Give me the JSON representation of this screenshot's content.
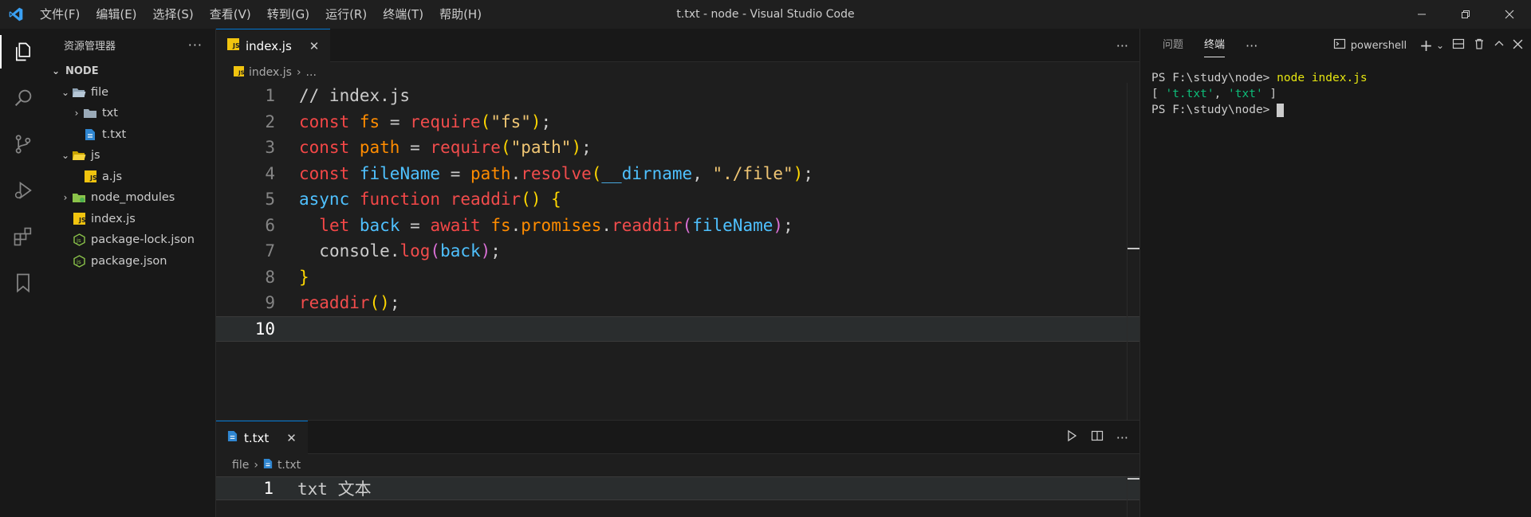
{
  "window": {
    "title": "t.txt - node - Visual Studio Code",
    "menus": [
      "文件(F)",
      "编辑(E)",
      "选择(S)",
      "查看(V)",
      "转到(G)",
      "运行(R)",
      "终端(T)",
      "帮助(H)"
    ]
  },
  "sidebar": {
    "title": "资源管理器",
    "root": "NODE",
    "items": [
      {
        "label": "file",
        "type": "folder-open"
      },
      {
        "label": "txt",
        "type": "folder"
      },
      {
        "label": "t.txt",
        "type": "txt-file"
      },
      {
        "label": "js",
        "type": "folder-open-js"
      },
      {
        "label": "a.js",
        "type": "js-file"
      },
      {
        "label": "node_modules",
        "type": "node-folder"
      },
      {
        "label": "index.js",
        "type": "js-file"
      },
      {
        "label": "package-lock.json",
        "type": "json-file"
      },
      {
        "label": "package.json",
        "type": "json-file"
      }
    ]
  },
  "editor1": {
    "tab_label": "index.js",
    "breadcrumb_file": "index.js",
    "breadcrumb_more": "...",
    "line_numbers": [
      "1",
      "2",
      "3",
      "4",
      "5",
      "6",
      "7",
      "8",
      "9",
      "10"
    ],
    "current_line": 10,
    "code": [
      "// index.js",
      "const fs = require(\"fs\");",
      "const path = require(\"path\");",
      "const fileName = path.resolve(__dirname, \"./file\");",
      "async function readdir() {",
      "  let back = await fs.promises.readdir(fileName);",
      "  console.log(back);",
      "}",
      "readdir();",
      ""
    ]
  },
  "editor2": {
    "tab_label": "t.txt",
    "breadcrumb_folder": "file",
    "breadcrumb_file": "t.txt",
    "line_number": "1",
    "content": "txt 文本"
  },
  "panel": {
    "tabs": [
      "问题",
      "终端"
    ],
    "active_tab": "终端",
    "shell": "powershell",
    "terminal_lines": [
      {
        "prompt": "PS F:\\study\\node> ",
        "cmd": "node index.js"
      },
      {
        "output": "[ 't.txt', 'txt' ]"
      },
      {
        "prompt": "PS F:\\study\\node> ",
        "cmd": ""
      }
    ],
    "output_strings": [
      "'t.txt'",
      "'txt'"
    ]
  },
  "colors": {
    "accent": "#0078d4",
    "background": "#1e1e1e",
    "sidebar": "#181818"
  }
}
